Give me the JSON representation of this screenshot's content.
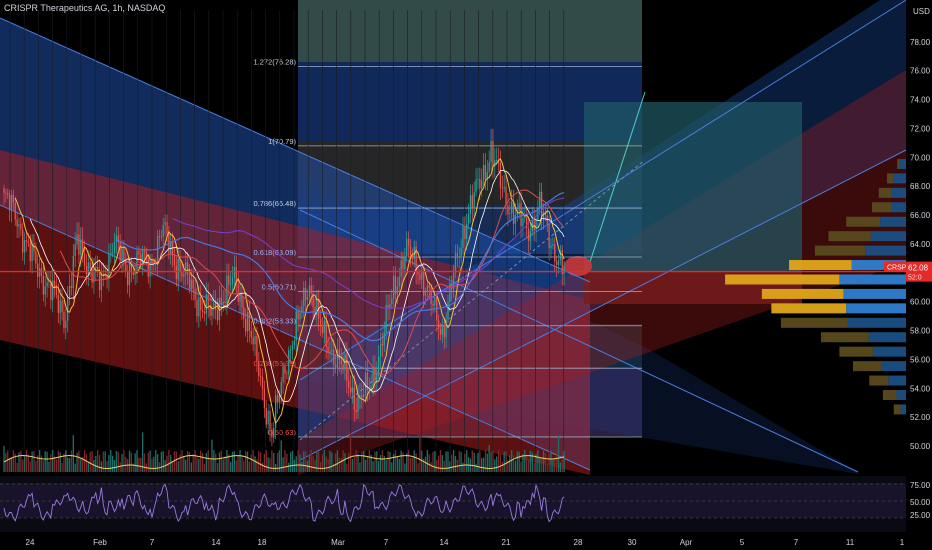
{
  "header": {
    "title": "CRISPR Therapeutics AG, 1h, NASDAQ",
    "currency": "USD"
  },
  "price_tag": {
    "symbol": "CRSP",
    "price": "62.08",
    "sub": "52:0"
  },
  "colors": {
    "bull": "#26a69a",
    "bear": "#ef5350",
    "price_line": "#e52a2a",
    "fib_line": "#9fb0c8"
  },
  "chart_data": {
    "type": "line",
    "title": "CRISPR Therapeutics AG, 1h, NASDAQ",
    "xlabel": "",
    "ylabel": "USD",
    "ylim": [
      48.2,
      80.2
    ],
    "x_ticks": [
      "24",
      "Feb",
      "7",
      "14",
      "18",
      "Mar",
      "7",
      "14",
      "21",
      "28",
      "30",
      "Apr",
      "5",
      "7",
      "11",
      "1"
    ],
    "y_ticks": [
      "78.00",
      "76.00",
      "74.00",
      "72.00",
      "70.00",
      "68.00",
      "66.00",
      "64.00",
      "62.00",
      "60.00",
      "58.00",
      "56.00",
      "54.00",
      "52.00",
      "50.00"
    ],
    "rsi_ticks": [
      "75.00",
      "50.00",
      "25.00"
    ],
    "fib_levels": [
      {
        "label": "1.272(76.28)",
        "value": 76.28
      },
      {
        "label": "1(70.79)",
        "value": 70.79
      },
      {
        "label": "0.786(66.48)",
        "value": 66.48
      },
      {
        "label": "0.618(63.09)",
        "value": 63.09
      },
      {
        "label": "0.5(60.71)",
        "value": 60.71
      },
      {
        "label": "0.382(58.33)",
        "value": 58.33
      },
      {
        "label": "0.236(55.39)",
        "value": 55.39
      },
      {
        "label": "0(50.63)",
        "value": 50.63
      }
    ],
    "series": [
      {
        "values": [
          67.2,
          66.0,
          63.5,
          62.0,
          60.5,
          59.0,
          64.0,
          62.5,
          61.0,
          64.5,
          62.0,
          63.0,
          62.5,
          65.0,
          63.0,
          61.5,
          60.0,
          59.0,
          60.5,
          61.5,
          58.5,
          55.0,
          50.6,
          55.5,
          58.0,
          61.5,
          58.0,
          56.5,
          55.0,
          53.0,
          54.0,
          57.0,
          61.0,
          63.5,
          62.5,
          60.0,
          58.0,
          62.0,
          66.0,
          68.0,
          70.5,
          67.5,
          66.0,
          65.0,
          66.5,
          64.0,
          62.0
        ]
      }
    ],
    "volume_profile": [
      {
        "price": 69.5,
        "up": 4,
        "down": 9
      },
      {
        "price": 68.5,
        "up": 10,
        "down": 18
      },
      {
        "price": 67.5,
        "up": 18,
        "down": 22
      },
      {
        "price": 66.5,
        "up": 28,
        "down": 22
      },
      {
        "price": 65.5,
        "up": 50,
        "down": 38
      },
      {
        "price": 64.5,
        "up": 62,
        "down": 52
      },
      {
        "price": 63.5,
        "up": 74,
        "down": 60
      },
      {
        "price": 62.5,
        "up": 92,
        "down": 80
      },
      {
        "price": 61.5,
        "up": 168,
        "down": 98
      },
      {
        "price": 60.5,
        "up": 120,
        "down": 92
      },
      {
        "price": 59.5,
        "up": 110,
        "down": 88
      },
      {
        "price": 58.5,
        "up": 98,
        "down": 86
      },
      {
        "price": 57.5,
        "up": 70,
        "down": 55
      },
      {
        "price": 56.5,
        "up": 50,
        "down": 48
      },
      {
        "price": 55.5,
        "up": 42,
        "down": 36
      },
      {
        "price": 54.5,
        "up": 28,
        "down": 26
      },
      {
        "price": 53.5,
        "up": 20,
        "down": 14
      },
      {
        "price": 52.5,
        "up": 10,
        "down": 8
      }
    ]
  }
}
